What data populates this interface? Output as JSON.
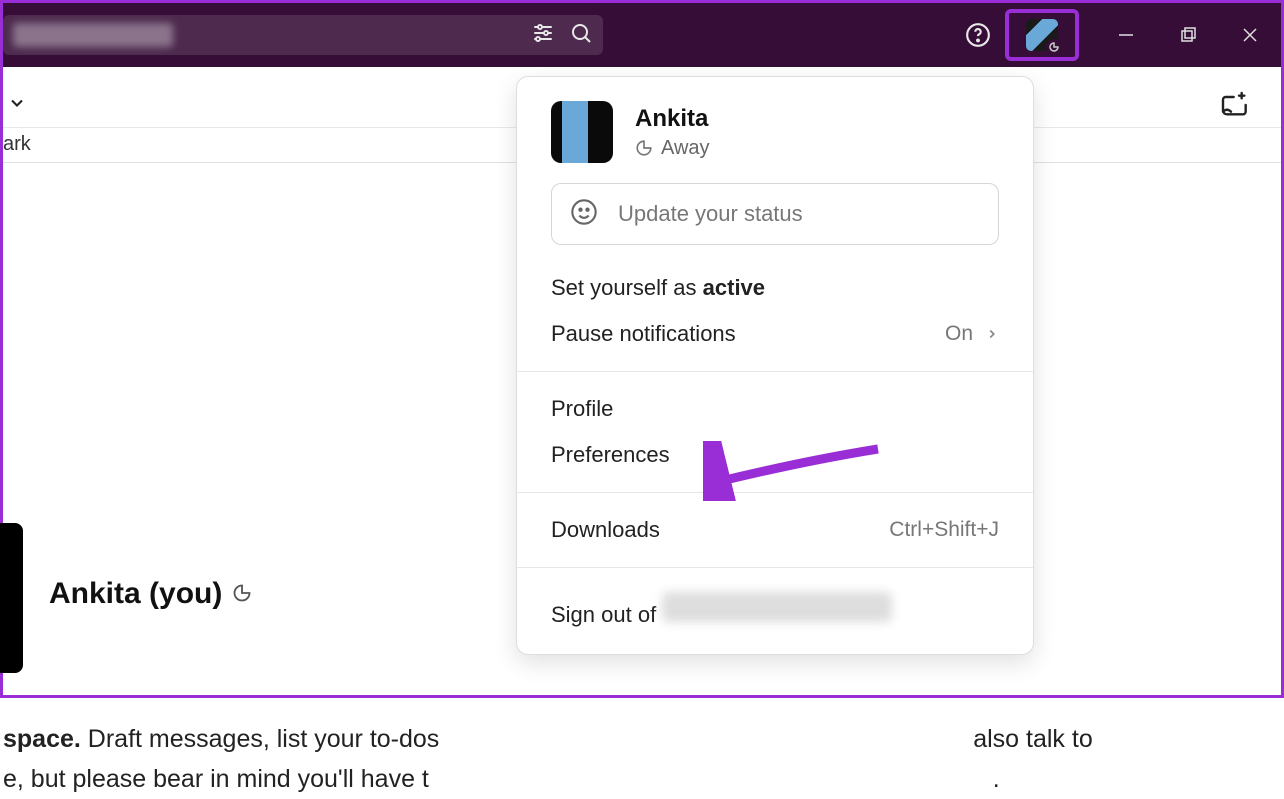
{
  "titlebar": {
    "search_placeholder": "",
    "help_tooltip": "Help"
  },
  "window_controls": {
    "minimize": "Minimize",
    "maximize": "Maximize",
    "close": "Close"
  },
  "subheader": {
    "bookmark_fragment": "ark"
  },
  "main": {
    "user_title": "Ankita (you)",
    "body_line1_bold_fragment": " space.",
    "body_line1_rest": " Draft messages, list your to-dos",
    "body_line1_tail": "also talk to",
    "body_line2": "e, but please bear in mind you'll have t",
    "body_line2_tail": "."
  },
  "user_menu": {
    "name": "Ankita",
    "status_label": "Away",
    "status_placeholder": "Update your status",
    "set_active_prefix": "Set yourself as ",
    "set_active_bold": "active",
    "pause_notifications": "Pause notifications",
    "pause_value": "On",
    "profile": "Profile",
    "preferences": "Preferences",
    "downloads": "Downloads",
    "downloads_shortcut": "Ctrl+Shift+J",
    "sign_out_prefix": "Sign out of "
  },
  "annotation": {
    "target": "preferences",
    "color": "#9a2ed6"
  }
}
